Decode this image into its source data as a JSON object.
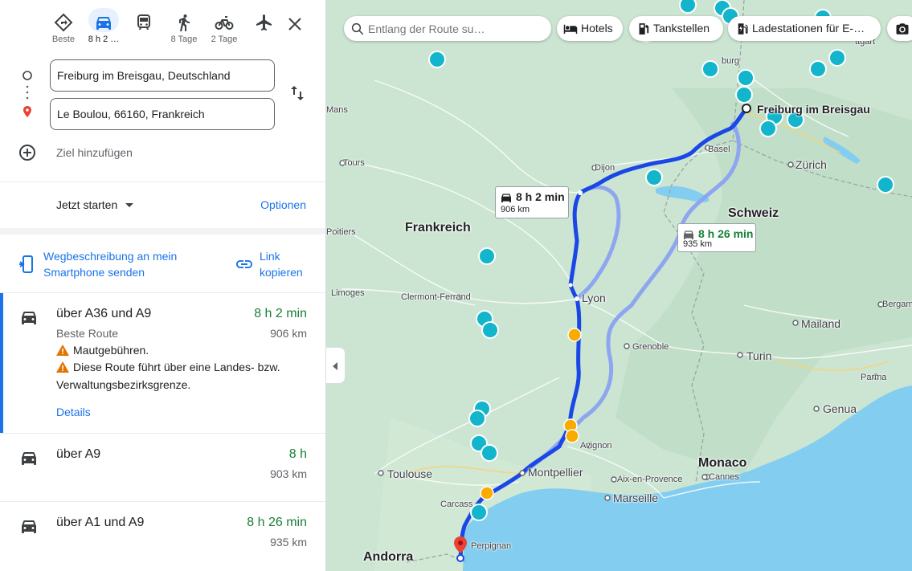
{
  "modes": [
    {
      "label": "Beste",
      "icon": "best-route-icon"
    },
    {
      "label": "8 h 2 …",
      "icon": "car-icon"
    },
    {
      "label": "",
      "icon": "transit-icon"
    },
    {
      "label": "8 Tage",
      "icon": "walk-icon"
    },
    {
      "label": "2 Tage",
      "icon": "bike-icon"
    },
    {
      "label": "",
      "icon": "flight-icon"
    }
  ],
  "origin": "Freiburg im Breisgau, Deutschland",
  "destination": "Le Boulou, 66160, Frankreich",
  "add_destination": "Ziel hinzufügen",
  "start_label": "Jetzt starten",
  "options_label": "Optionen",
  "send_to_phone": "Wegbeschreibung an mein Smartphone senden",
  "copy_link": "Link kopieren",
  "routes": [
    {
      "name": "über A36 und A9",
      "time": "8 h 2 min",
      "sub": "Beste Route",
      "distance": "906 km",
      "warnings": [
        "Mautgebühren.",
        "Diese Route führt über eine Landes- bzw. Verwaltungsbezirksgrenze."
      ],
      "details": "Details"
    },
    {
      "name": "über A9",
      "time": "8 h",
      "distance": "903 km"
    },
    {
      "name": "über A1 und A9",
      "time": "8 h 26 min",
      "distance": "935 km"
    }
  ],
  "map": {
    "search_placeholder": "Entlang der Route su…",
    "chips": [
      "Hotels",
      "Tankstellen",
      "Ladestationen für E-…"
    ],
    "countries": [
      "Frankreich",
      "Schweiz",
      "Monaco",
      "Andorra"
    ],
    "cities": [
      "Freiburg im Breisgau",
      "Lyon",
      "Montpellier",
      "Toulouse",
      "Marseille",
      "Turin",
      "Mailand",
      "Genua",
      "Zürich"
    ],
    "small_places": [
      "Dijon",
      "Basel",
      "Tours",
      "Poitiers",
      "Limoges",
      "Clermont-Ferrand",
      "Grenoble",
      "Avignon",
      "Aix-en-Provence",
      "Cannes",
      "Perpignan",
      "Carcass",
      "Bergamo",
      "Parma",
      "Mans",
      "burg",
      "ttgart"
    ],
    "route_boxes": [
      {
        "time": "8 h 2 min",
        "distance": "906 km"
      },
      {
        "time": "8 h 26 min",
        "distance": "935 km"
      }
    ]
  },
  "colors": {
    "accent": "#1a73e8",
    "green": "#188038",
    "route": "#1a47e5",
    "alt_route": "#8ea6f0",
    "sea": "#82cdf0",
    "land": "#cbe5d2"
  }
}
